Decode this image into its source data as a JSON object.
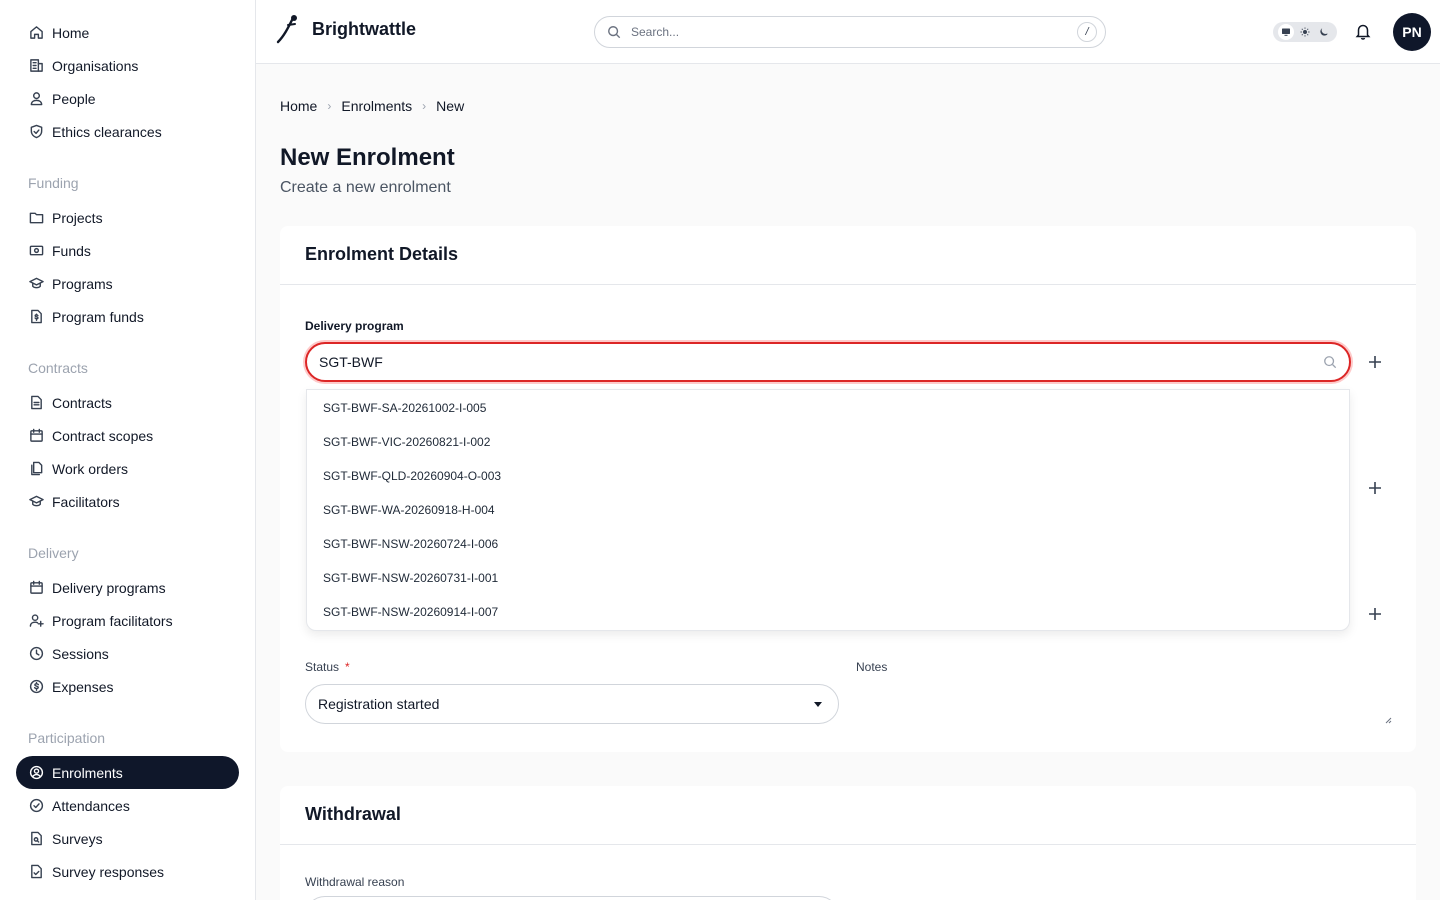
{
  "sidebar": {
    "top_items": [
      {
        "label": "Home",
        "icon": "home-icon"
      },
      {
        "label": "Organisations",
        "icon": "building-icon"
      },
      {
        "label": "People",
        "icon": "user-icon"
      },
      {
        "label": "Ethics clearances",
        "icon": "shield-check-icon"
      }
    ],
    "sections": [
      {
        "title": "Funding",
        "items": [
          {
            "label": "Projects",
            "icon": "folder-icon"
          },
          {
            "label": "Funds",
            "icon": "banknote-icon"
          },
          {
            "label": "Programs",
            "icon": "graduation-cap-icon"
          },
          {
            "label": "Program funds",
            "icon": "file-dollar-icon"
          }
        ]
      },
      {
        "title": "Contracts",
        "items": [
          {
            "label": "Contracts",
            "icon": "file-text-icon"
          },
          {
            "label": "Contract scopes",
            "icon": "calendar-icon"
          },
          {
            "label": "Work orders",
            "icon": "files-icon"
          },
          {
            "label": "Facilitators",
            "icon": "graduation-cap-icon"
          }
        ]
      },
      {
        "title": "Delivery",
        "items": [
          {
            "label": "Delivery programs",
            "icon": "calendar-icon"
          },
          {
            "label": "Program facilitators",
            "icon": "user-plus-icon"
          },
          {
            "label": "Sessions",
            "icon": "clock-icon"
          },
          {
            "label": "Expenses",
            "icon": "dollar-circle-icon"
          }
        ]
      },
      {
        "title": "Participation",
        "items": [
          {
            "label": "Enrolments",
            "icon": "user-circle-icon",
            "active": true
          },
          {
            "label": "Attendances",
            "icon": "check-circle-icon"
          },
          {
            "label": "Surveys",
            "icon": "file-search-icon"
          },
          {
            "label": "Survey responses",
            "icon": "file-check-icon"
          }
        ]
      }
    ]
  },
  "header": {
    "app_name": "Brightwattle",
    "search_placeholder": "Search...",
    "search_shortcut": "/",
    "avatar_initials": "PN",
    "theme_options": [
      "monitor-icon",
      "sun-icon",
      "moon-icon"
    ]
  },
  "breadcrumb": [
    "Home",
    "Enrolments",
    "New"
  ],
  "page": {
    "title": "New Enrolment",
    "subtitle": "Create a new enrolment"
  },
  "details_card": {
    "title": "Enrolment Details",
    "delivery_program_label": "Delivery program",
    "delivery_program_value": "SGT-BWF",
    "dropdown_options": [
      "SGT-BWF-SA-20261002-I-005",
      "SGT-BWF-VIC-20260821-I-002",
      "SGT-BWF-QLD-20260904-O-003",
      "SGT-BWF-WA-20260918-H-004",
      "SGT-BWF-NSW-20260724-I-006",
      "SGT-BWF-NSW-20260731-I-001",
      "SGT-BWF-NSW-20260914-I-007"
    ],
    "status_label": "Status",
    "status_required": "*",
    "status_value": "Registration started",
    "notes_label": "Notes"
  },
  "withdrawal_card": {
    "title": "Withdrawal",
    "reason_label": "Withdrawal reason"
  },
  "colors": {
    "accent_dark": "#0f172a",
    "error": "#dc2626"
  }
}
